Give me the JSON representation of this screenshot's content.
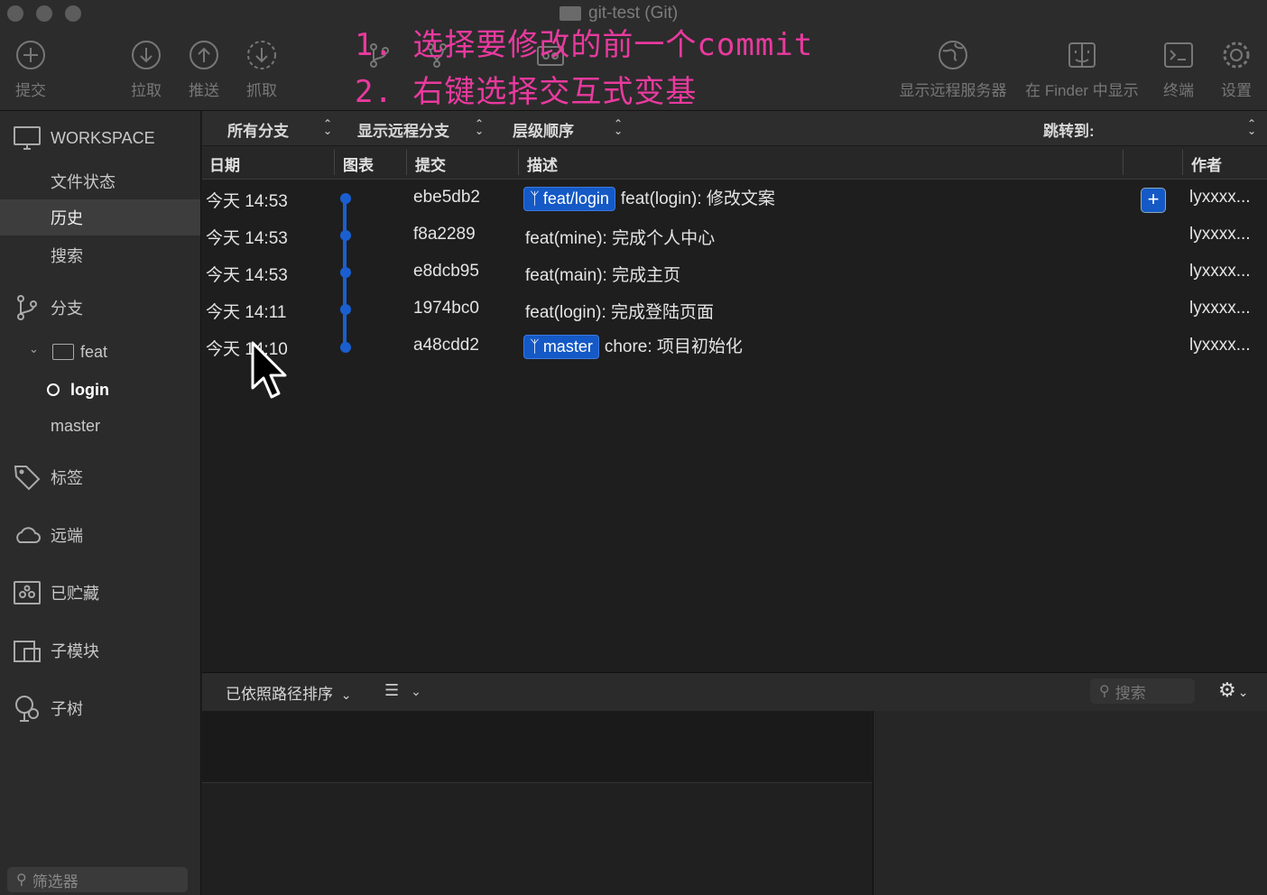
{
  "window": {
    "title": "git-test (Git)"
  },
  "toolbar": {
    "commit": "提交",
    "pull": "拉取",
    "push": "推送",
    "fetch": "抓取",
    "branch": "分支",
    "merge": "合并",
    "stash": "贮藏",
    "show_remote": "显示远程服务器",
    "show_in_finder": "在 Finder 中显示",
    "terminal": "终端",
    "settings": "设置"
  },
  "overlay": {
    "line1": "1. 选择要修改的前一个commit",
    "line2": "2. 右键选择交互式变基"
  },
  "sidebar": {
    "workspace_title": "WORKSPACE",
    "items": [
      {
        "label": "文件状态"
      },
      {
        "label": "历史"
      },
      {
        "label": "搜索"
      }
    ],
    "branches_title": "分支",
    "folder_feat": "feat",
    "branch_login": "login",
    "branch_master": "master",
    "tags": "标签",
    "remotes": "远端",
    "stashes": "已贮藏",
    "submodules": "子模块",
    "subtrees": "子树",
    "filter_placeholder": "筛选器"
  },
  "filters": {
    "all_branches": "所有分支",
    "show_remote_branches": "显示远程分支",
    "order": "层级顺序",
    "jump_to": "跳转到:"
  },
  "columns": {
    "date": "日期",
    "graph": "图表",
    "commit": "提交",
    "description": "描述",
    "author": "作者"
  },
  "commits": [
    {
      "date": "今天 14:53",
      "hash": "ebe5db2",
      "tag": "feat/login",
      "message": "feat(login): 修改文案",
      "author": "lyxxxx..."
    },
    {
      "date": "今天 14:53",
      "hash": "f8a2289",
      "tag": "",
      "message": "feat(mine): 完成个人中心",
      "author": "lyxxxx..."
    },
    {
      "date": "今天 14:53",
      "hash": "e8dcb95",
      "tag": "",
      "message": "feat(main): 完成主页",
      "author": "lyxxxx..."
    },
    {
      "date": "今天 14:11",
      "hash": "1974bc0",
      "tag": "",
      "message": "feat(login): 完成登陆页面",
      "author": "lyxxxx..."
    },
    {
      "date": "今天 14:10",
      "hash": "a48cdd2",
      "tag": "master",
      "message": "chore: 项目初始化",
      "author": "lyxxxx..."
    }
  ],
  "bottom": {
    "sort_label": "已依照路径排序",
    "search_placeholder": "搜索"
  },
  "colors": {
    "accent": "#1459c6",
    "overlay_text": "#e83a9e"
  }
}
